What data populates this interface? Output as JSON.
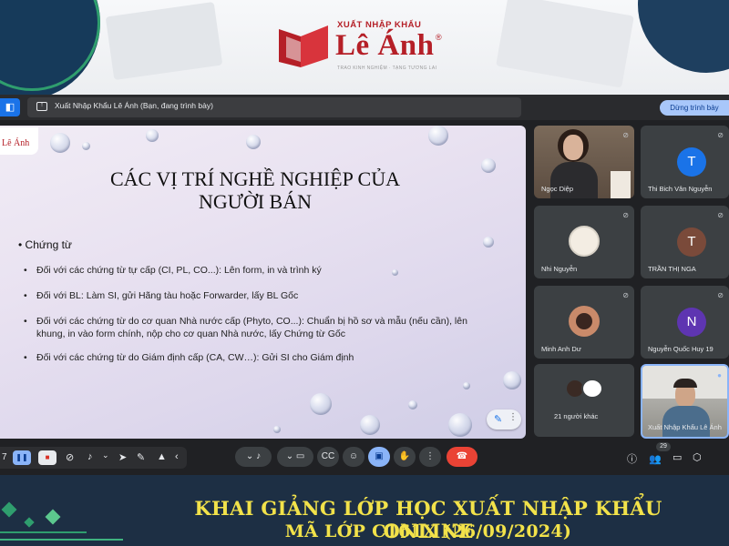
{
  "brand": {
    "tagline": "XUẤT NHẬP KHẨU",
    "name": "Lê Ánh",
    "registered": "®",
    "slogan": "TRAO KINH NGHIỆM · TẠNG TƯƠNG LAI"
  },
  "meet": {
    "presenting_text": "Xuất Nhập Khẩu Lê Ánh (Bạn, đang trình bày)",
    "stop_presenting": "Dừng trình bày",
    "slide": {
      "logo": "Lê Ánh",
      "title_line1": "CÁC VỊ TRÍ NGHỀ NGHIỆP CỦA",
      "title_line2": "NGƯỜI BÁN",
      "heading": "• Chứng từ",
      "bullets": [
        "Đối với các chứng từ tự cấp (CI, PL, CO...): Lên form, in và trình ký",
        "Đối với BL: Làm SI, gửi Hãng tàu hoặc Forwarder, lấy BL Gốc",
        "Đối với các chứng từ do cơ quan Nhà nước cấp (Phyto, CO...): Chuẩn bị hồ sơ và mẫu (nếu cần), lên khung, in vào form chính, nộp cho cơ quan Nhà nước, lấy Chứng từ Gốc",
        "Đối với các chứng từ do Giám định cấp (CA, CW…): Gửi SI cho Giám định"
      ]
    },
    "participants": [
      {
        "name": "Ngọc Diệp",
        "type": "video"
      },
      {
        "name": "Thi Bich Vân Nguyễn",
        "initial": "T",
        "color": "#1a73e8"
      },
      {
        "name": "Nhi Nguyễn",
        "type": "photo"
      },
      {
        "name": "TRẦN THỊ NGA",
        "initial": "T",
        "color": "#7a4a3a"
      },
      {
        "name": "Minh Anh Dư",
        "type": "photo"
      },
      {
        "name": "Nguyễn Quốc Huy 19",
        "initial": "N",
        "color": "#5e35b1"
      },
      {
        "name": "21 người khác",
        "type": "group"
      },
      {
        "name": "Xuất Nhập Khẩu Lê Ánh",
        "type": "video"
      }
    ],
    "participant_count": "29",
    "slide_number": "7"
  },
  "footer": {
    "line1": "KHAI GIẢNG LỚP HỌC XUẤT NHẬP KHẨU ONLINE",
    "line2": "MÃ LỚP C161X (26/09/2024)"
  },
  "colors": {
    "brand_red": "#b51f27",
    "footer_bg": "#1d2f44",
    "footer_text": "#f2e24a",
    "accent_green": "#2f9e6e",
    "meet_bg": "#202124"
  }
}
